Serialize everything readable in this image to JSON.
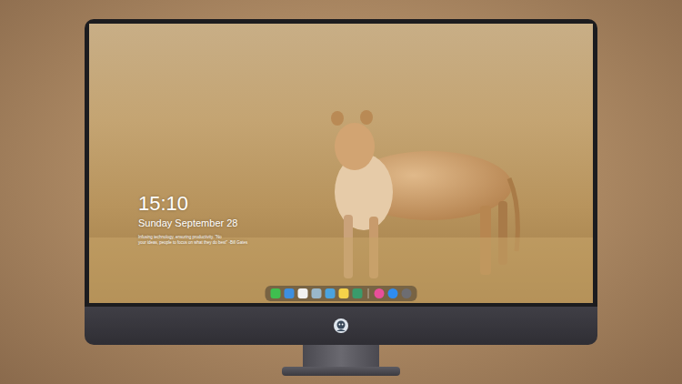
{
  "lock_screen": {
    "time": "15:10",
    "date": "Sunday September 28",
    "caption": [
      "Infusing technology, ensuring productivity. \"No",
      "your ideas, people to focus on what they do best\" -Bill Gates"
    ]
  },
  "dock": {
    "pinned": [
      {
        "color": "#3fbf4f"
      },
      {
        "color": "#3d8fe0"
      },
      {
        "color": "#f2f2f2"
      },
      {
        "color": "#9ab7c9"
      },
      {
        "color": "#4aa3df"
      },
      {
        "color": "#f5d24a"
      },
      {
        "color": "#3a9b6b"
      }
    ],
    "recent": [
      {
        "color": "#e94f9a"
      },
      {
        "color": "#2f8cf0"
      },
      {
        "color": "#6d6d72"
      }
    ]
  }
}
